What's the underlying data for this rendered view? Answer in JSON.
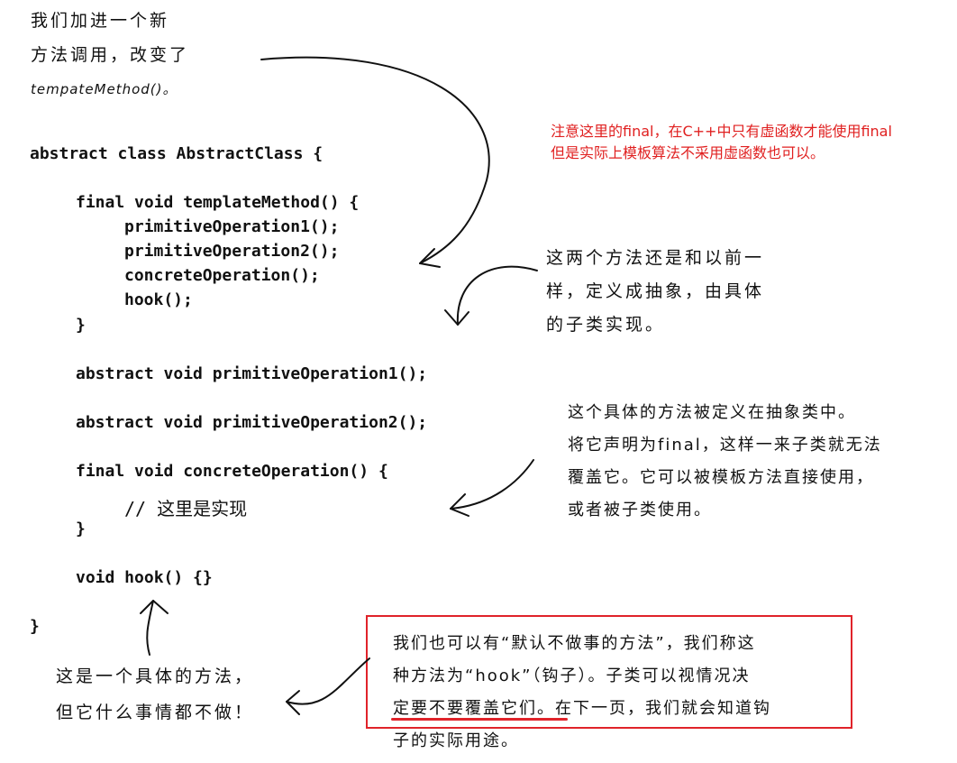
{
  "note_top": [
    "我们加进一个新",
    "方法调用，改变了",
    "tempateMethod()。"
  ],
  "red_note": [
    "注意这里的final，在C++中只有虚函数才能使用final",
    "但是实际上模板算法不采用虚函数也可以。"
  ],
  "code_lines": [
    "abstract class AbstractClass {",
    "final void templateMethod() {",
    "primitiveOperation1();",
    "primitiveOperation2();",
    "concreteOperation();",
    "hook();",
    "}",
    "abstract void primitiveOperation1();",
    "abstract void primitiveOperation2();",
    "final void concreteOperation() {",
    "// 这里是实现",
    "}",
    "void hook() {}",
    "}"
  ],
  "note_abstract": [
    "这两个方法还是和以前一",
    "样，定义成抽象，由具体",
    "的子类实现。"
  ],
  "note_concrete": [
    "这个具体的方法被定义在抽象类中。",
    "将它声明为final，这样一来子类就无法",
    "覆盖它。它可以被模板方法直接使用，",
    "或者被子类使用。"
  ],
  "note_hook_left": [
    "这是一个具体的方法，",
    "但它什么事情都不做！"
  ],
  "note_hook_box": [
    "我们也可以有“默认不做事的方法”，我们称这",
    "种方法为“hook”（钩子）。子类可以视情况决",
    "定要不要覆盖它们。在下一页，我们就会知道钩",
    "子的实际用途。"
  ],
  "colors": {
    "red": "#e0232a",
    "ink": "#111111"
  }
}
